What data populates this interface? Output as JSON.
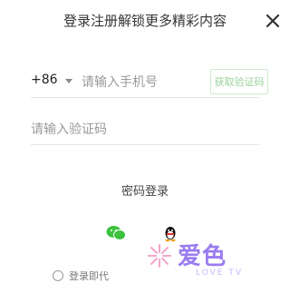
{
  "header": {
    "title": "登录注册解锁更多精彩内容",
    "close_icon": "close-icon"
  },
  "phone": {
    "country_code": "+86",
    "placeholder": "请输入手机号",
    "get_code_label": "获取验证码"
  },
  "code": {
    "placeholder": "请输入验证码"
  },
  "alt_login": {
    "password_login_label": "密码登录",
    "icons": [
      "wechat-icon",
      "qq-icon"
    ]
  },
  "auto_login": {
    "label": "登录即代"
  },
  "watermark": {
    "text": "爱色",
    "sub_text": "LOVE TV"
  },
  "colors": {
    "accent_green": "#9ad19a",
    "wechat_green": "#3cc23c",
    "watermark_purple": "#9a7cf0"
  }
}
